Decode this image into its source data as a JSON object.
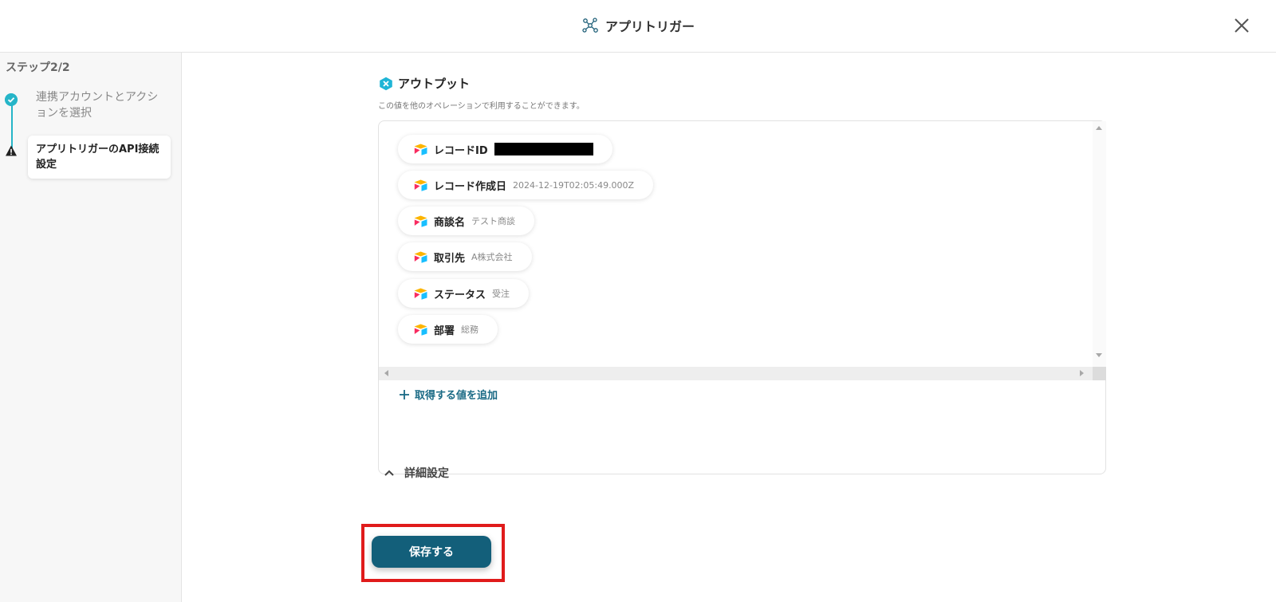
{
  "header": {
    "title": "アプリトリガー",
    "close_icon": "close-icon",
    "app_icon": "network-icon"
  },
  "sidebar": {
    "step_title": "ステップ2/2",
    "steps": [
      {
        "label": "連携アカウントとアクションを選択",
        "status": "completed",
        "icon": "check-circle-icon"
      },
      {
        "label": "アプリトリガーのAPI接続設定",
        "status": "warning",
        "icon": "warning-icon"
      }
    ]
  },
  "output": {
    "heading": "アウトプット",
    "description": "この値を他のオペレーションで利用することができます。",
    "items": [
      {
        "label": "レコードID",
        "value": "",
        "redacted": true
      },
      {
        "label": "レコード作成日",
        "value": "2024-12-19T02:05:49.000Z"
      },
      {
        "label": "商談名",
        "value": "テスト商談"
      },
      {
        "label": "取引先",
        "value": "A株式会社"
      },
      {
        "label": "ステータス",
        "value": "受注"
      },
      {
        "label": "部署",
        "value": "総務"
      }
    ],
    "add_label": "取得する値を追加"
  },
  "detail_settings": {
    "label": "詳細設定"
  },
  "save_button": {
    "label": "保存する"
  },
  "colors": {
    "accent": "#26b5c8",
    "primary_button": "#135f7a",
    "highlight": "#e01b1b",
    "link": "#1a6a85"
  }
}
